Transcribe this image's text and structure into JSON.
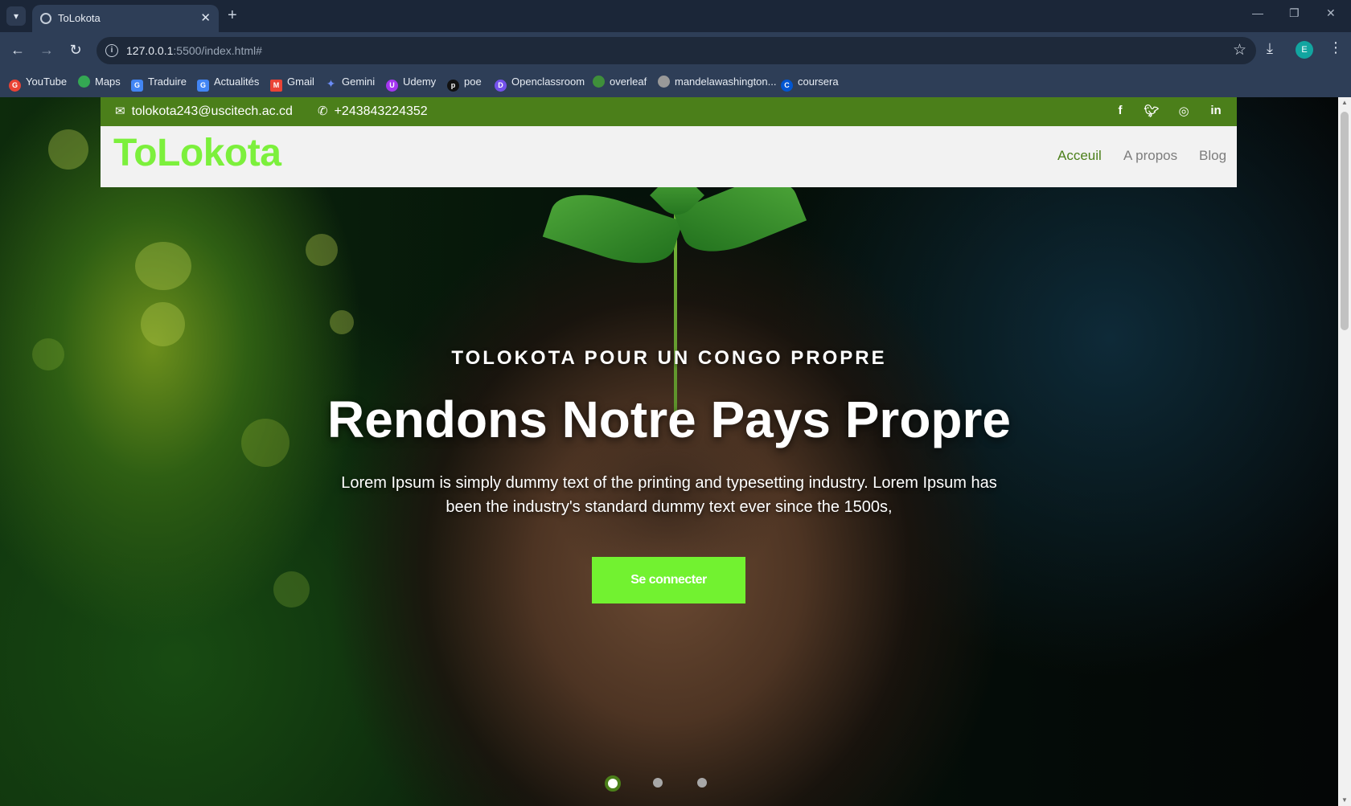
{
  "browser": {
    "tab_title": "ToLokota",
    "url_host": "127.0.0.1",
    "url_rest": ":5500/index.html#",
    "profile_initial": "E",
    "bookmarks": [
      {
        "label": "YouTube",
        "icon": "google-icon",
        "color": "#ea4335"
      },
      {
        "label": "Maps",
        "icon": "maps-icon",
        "color": "#34a853"
      },
      {
        "label": "Traduire",
        "icon": "translate-icon",
        "color": "#4285f4"
      },
      {
        "label": "Actualités",
        "icon": "news-icon",
        "color": "#4285f4"
      },
      {
        "label": "Gmail",
        "icon": "gmail-icon",
        "color": "#ea4335"
      },
      {
        "label": "Gemini",
        "icon": "gemini-icon",
        "color": "#6b8cf7"
      },
      {
        "label": "Udemy",
        "icon": "udemy-icon",
        "color": "#a435f0"
      },
      {
        "label": "poe",
        "icon": "poe-icon",
        "color": "#111111"
      },
      {
        "label": "Openclassroom",
        "icon": "openclassroom-icon",
        "color": "#7451eb"
      },
      {
        "label": "overleaf",
        "icon": "overleaf-icon",
        "color": "#3f8f3a"
      },
      {
        "label": "mandelawashington...",
        "icon": "mandela-icon",
        "color": "#999999"
      },
      {
        "label": "coursera",
        "icon": "coursera-icon",
        "color": "#0056d2"
      }
    ]
  },
  "topbar": {
    "email": "tolokota243@uscitech.ac.cd",
    "phone": "+243843224352",
    "social": [
      "f",
      "t",
      "ig",
      "in"
    ]
  },
  "navbar": {
    "brand": "ToLokota",
    "links": [
      "Acceuil",
      "A propos",
      "Blog"
    ],
    "active_index": 0
  },
  "hero": {
    "kicker": "TOLOKOTA POUR UN CONGO PROPRE",
    "headline": "Rendons Notre Pays Propre",
    "lead": "Lorem Ipsum is simply dummy text of the printing and typesetting industry. Lorem Ipsum has been the industry's standard dummy text ever since the 1500s,",
    "cta_label": "Se connecter",
    "carousel_active": 1,
    "carousel_count": 3
  },
  "colors": {
    "brand_green": "#7cf03c",
    "topbar_green": "#4b7f1a",
    "cta_green": "#72f230"
  }
}
